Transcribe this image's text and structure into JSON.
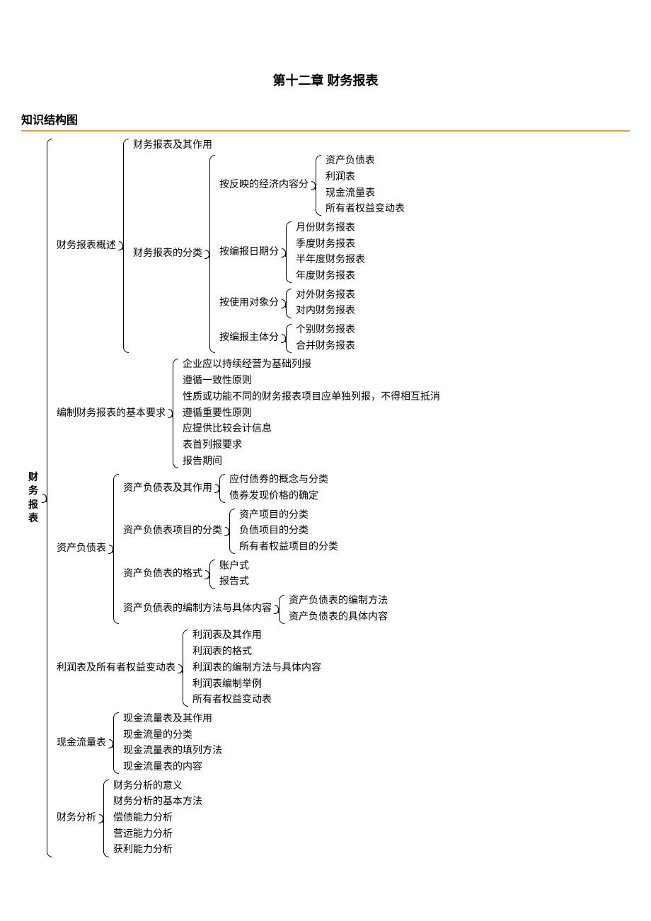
{
  "page_title": "第十二章 财务报表",
  "section_title": "知识结构图",
  "root": {
    "label": "财务报表",
    "vertical": true,
    "children": [
      {
        "label": "财务报表概述",
        "children": [
          {
            "label": "财务报表及其作用"
          },
          {
            "label": "财务报表的分类",
            "children": [
              {
                "label": "按反映的经济内容分",
                "children": [
                  {
                    "label": "资产负债表"
                  },
                  {
                    "label": "利润表"
                  },
                  {
                    "label": "现金流量表"
                  },
                  {
                    "label": "所有者权益变动表"
                  }
                ]
              },
              {
                "label": "按编报日期分",
                "children": [
                  {
                    "label": "月份财务报表"
                  },
                  {
                    "label": "季度财务报表"
                  },
                  {
                    "label": "半年度财务报表"
                  },
                  {
                    "label": "年度财务报表"
                  }
                ]
              },
              {
                "label": "按使用对象分",
                "children": [
                  {
                    "label": "对外财务报表"
                  },
                  {
                    "label": "对内财务报表"
                  }
                ]
              },
              {
                "label": "按编报主体分",
                "children": [
                  {
                    "label": "个别财务报表"
                  },
                  {
                    "label": "合并财务报表"
                  }
                ]
              }
            ]
          }
        ]
      },
      {
        "label": "编制财务报表的基本要求",
        "children": [
          {
            "label": "企业应以持续经营为基础列报"
          },
          {
            "label": "遵循一致性原则"
          },
          {
            "label": "性质或功能不同的财务报表项目应单独列报，不得相互抵消"
          },
          {
            "label": "遵循重要性原则"
          },
          {
            "label": "应提供比较会计信息"
          },
          {
            "label": "表首列报要求"
          },
          {
            "label": "报告期间"
          }
        ]
      },
      {
        "label": "资产负债表",
        "children": [
          {
            "label": "资产负债表及其作用",
            "children": [
              {
                "label": "应付债券的概念与分类"
              },
              {
                "label": "债券发现价格的确定"
              }
            ]
          },
          {
            "label": "资产负债表项目的分类",
            "children": [
              {
                "label": "资产项目的分类"
              },
              {
                "label": "负债项目的分类"
              },
              {
                "label": "所有者权益项目的分类"
              }
            ]
          },
          {
            "label": "资产负债表的格式",
            "children": [
              {
                "label": "账户式"
              },
              {
                "label": "报告式"
              }
            ]
          },
          {
            "label": "资产负债表的编制方法与具体内容",
            "children": [
              {
                "label": "资产负债表的编制方法"
              },
              {
                "label": "资产负债表的具体内容"
              }
            ]
          }
        ]
      },
      {
        "label": "利润表及所有者权益变动表",
        "children": [
          {
            "label": "利润表及其作用"
          },
          {
            "label": "利润表的格式"
          },
          {
            "label": "利润表的编制方法与具体内容"
          },
          {
            "label": "利润表编制举例"
          },
          {
            "label": "所有者权益变动表"
          }
        ]
      },
      {
        "label": "现金流量表",
        "children": [
          {
            "label": "现金流量表及其作用"
          },
          {
            "label": "现金流量的分类"
          },
          {
            "label": "现金流量表的填列方法"
          },
          {
            "label": "现金流量表的内容"
          }
        ]
      },
      {
        "label": "财务分析",
        "children": [
          {
            "label": "财务分析的意义"
          },
          {
            "label": "财务分析的基本方法"
          },
          {
            "label": "偿债能力分析"
          },
          {
            "label": "营运能力分析"
          },
          {
            "label": "获利能力分析"
          }
        ]
      }
    ]
  }
}
